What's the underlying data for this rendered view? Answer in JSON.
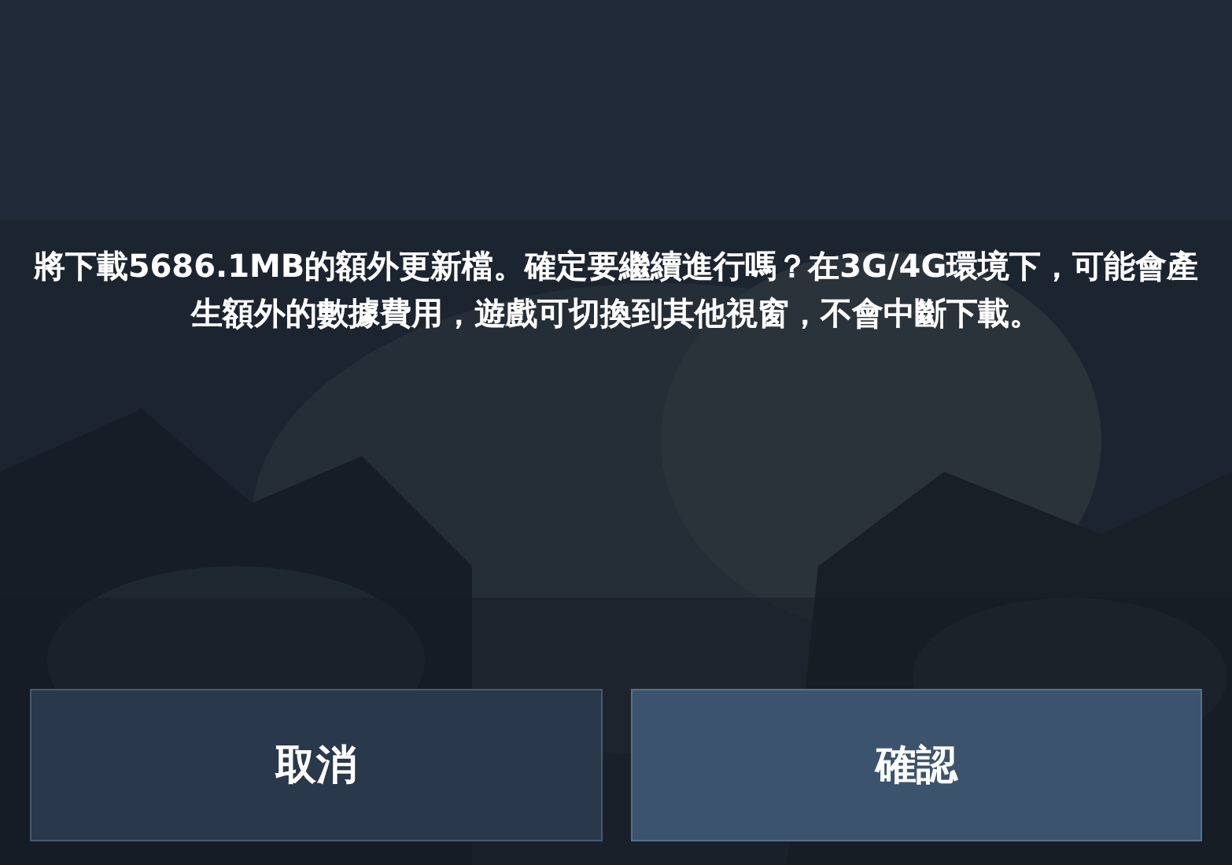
{
  "dialog": {
    "message": "將下載5686.1MB的額外更新檔。確定要繼續進行嗎？在3G/4G環境下，可能會產生額外的數據費用，遊戲可切換到其他視窗，不會中斷下載。"
  },
  "buttons": [
    {
      "label": "取消",
      "kind": "secondary"
    },
    {
      "label": "確認",
      "kind": "primary"
    }
  ]
}
